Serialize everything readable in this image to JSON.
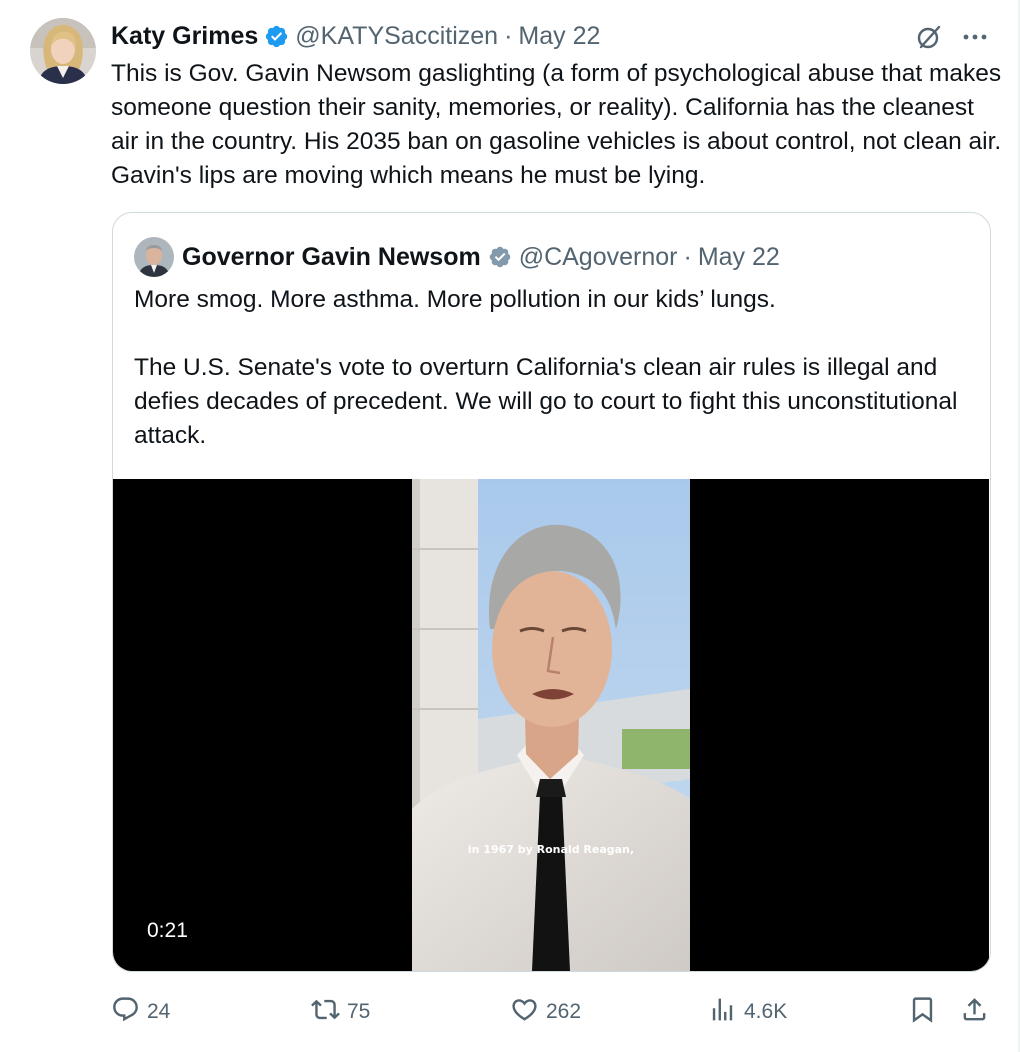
{
  "tweet": {
    "author": {
      "name": "Katy Grimes",
      "handle": "@KATYSaccitizen",
      "date": "May 22"
    },
    "separator": "·",
    "text": "This is Gov. Gavin Newsom gaslighting (a form of psychological abuse that makes someone question their sanity, memories, or reality). California has the cleanest air in the country. His 2035 ban on gasoline vehicles is about control, not clean air. Gavin's lips are moving which means he must be lying.",
    "icons": {
      "verified": "verified-badge-icon",
      "grok": "grok-icon",
      "more": "more-options-icon"
    }
  },
  "quoted": {
    "author": {
      "name": "Governor Gavin Newsom",
      "handle": "@CAgovernor",
      "date": "May 22"
    },
    "separator": "·",
    "paragraphs": [
      "More smog. More asthma. More pollution in our kids’ lungs.",
      "The U.S. Senate's vote to overturn California's clean air rules is illegal and defies decades of precedent. We will go to court to fight this unconstitutional attack."
    ],
    "video": {
      "caption": "in 1967 by Ronald Reagan,",
      "duration": "0:21"
    }
  },
  "actions": {
    "replies": "24",
    "reposts": "75",
    "likes": "262",
    "views": "4.6K"
  },
  "colors": {
    "text": "#0f1419",
    "secondary": "#536471",
    "verified": "#1d9bf0",
    "border": "#cfd9de",
    "video_bg": "#000000"
  }
}
